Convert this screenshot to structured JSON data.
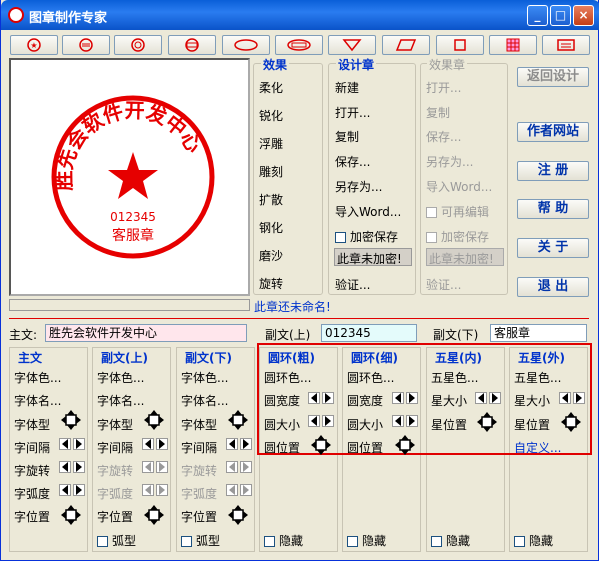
{
  "window": {
    "title": "图章制作专家"
  },
  "stamp": {
    "main_text": "胜先会软件开发中心",
    "sub_text_top": "012345",
    "sub_text_bottom": "客服章",
    "color": "#e60000"
  },
  "status": {
    "unnamed": "此章还未命名!"
  },
  "effects": {
    "header": "效果",
    "items": [
      "柔化",
      "锐化",
      "浮雕",
      "雕刻",
      "扩散",
      "钢化",
      "磨沙",
      "旋转"
    ]
  },
  "design": {
    "header": "设计章",
    "items": [
      "新建",
      "打开...",
      "复制",
      "保存...",
      "另存为...",
      "导入Word..."
    ],
    "encrypt_label": "加密保存",
    "status_box": "此章未加密!",
    "verify": "验证..."
  },
  "effect_stamp": {
    "header": "效果章",
    "items": [
      "打开...",
      "复制",
      "保存...",
      "另存为...",
      "导入Word..."
    ],
    "editable_label": "可再编辑",
    "encrypt_label": "加密保存",
    "status_box": "此章未加密!",
    "verify": "验证..."
  },
  "right_buttons": [
    "返回设计",
    "作者网站",
    "注 册",
    "帮 助",
    "关 于",
    "退 出"
  ],
  "fields": {
    "main_label": "主文:",
    "main_value": "胜先会软件开发中心",
    "sub_top_label": "副文(上)",
    "sub_top_value": "012345",
    "sub_bottom_label": "副文(下)",
    "sub_bottom_value": "客服章"
  },
  "panels": {
    "main": {
      "title": "主文",
      "rows": [
        "字体色...",
        "字体名...",
        "字体型",
        "字间隔",
        "字旋转",
        "字弧度",
        "字位置"
      ]
    },
    "subtop": {
      "title": "副文(上)",
      "rows": [
        "字体色...",
        "字体名...",
        "字体型",
        "字间隔",
        "字旋转",
        "字弧度",
        "字位置"
      ],
      "check": "弧型"
    },
    "subbottom": {
      "title": "副文(下)",
      "rows": [
        "字体色...",
        "字体名...",
        "字体型",
        "字间隔",
        "字旋转",
        "字弧度",
        "字位置"
      ],
      "check": "弧型"
    },
    "ring_thick": {
      "title": "圆环(粗)",
      "rows": [
        "圆环色...",
        "圆宽度",
        "圆大小",
        "圆位置"
      ],
      "check": "隐藏"
    },
    "ring_thin": {
      "title": "圆环(细)",
      "rows": [
        "圆环色...",
        "圆宽度",
        "圆大小",
        "圆位置"
      ],
      "check": "隐藏"
    },
    "star_inner": {
      "title": "五星(内)",
      "rows": [
        "五星色...",
        "星大小",
        "星位置"
      ],
      "check": "隐藏"
    },
    "star_outer": {
      "title": "五星(外)",
      "rows": [
        "五星色...",
        "星大小",
        "星位置"
      ],
      "link": "自定义...",
      "check": "隐藏"
    }
  }
}
